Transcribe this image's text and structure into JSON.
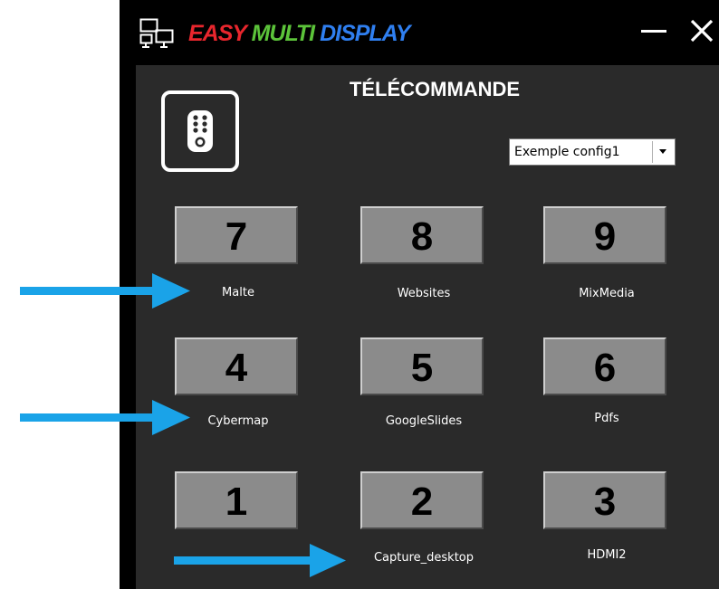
{
  "app": {
    "title_part1": "EASY",
    "title_part2": "MULTI",
    "title_part3": "DISPLAY",
    "logo_icon": "multi-display-icon",
    "minimize_icon": "minimize-icon",
    "close_icon": "close-icon"
  },
  "panel": {
    "title": "TÉLÉCOMMANDE",
    "remote_icon": "remote-control-icon",
    "config_select": {
      "value": "Exemple config1"
    }
  },
  "keys": [
    {
      "number": "7",
      "label": "Malte"
    },
    {
      "number": "8",
      "label": "Websites"
    },
    {
      "number": "9",
      "label": "MixMedia"
    },
    {
      "number": "4",
      "label": "Cybermap"
    },
    {
      "number": "5",
      "label": "GoogleSlides"
    },
    {
      "number": "6",
      "label": "Pdfs"
    },
    {
      "number": "1",
      "label": ""
    },
    {
      "number": "2",
      "label": "Capture_desktop"
    },
    {
      "number": "3",
      "label": "HDMI2"
    }
  ],
  "colors": {
    "title_red": "#e8262d",
    "title_green": "#5cc43a",
    "title_blue": "#2f7ff0",
    "panel_bg": "#2a2a2a",
    "key_bg": "#8b8b8b",
    "annotation_arrow": "#1aa3e8"
  },
  "annotations": [
    "arrow-to-malte",
    "arrow-to-cybermap",
    "arrow-to-capture-desktop"
  ]
}
